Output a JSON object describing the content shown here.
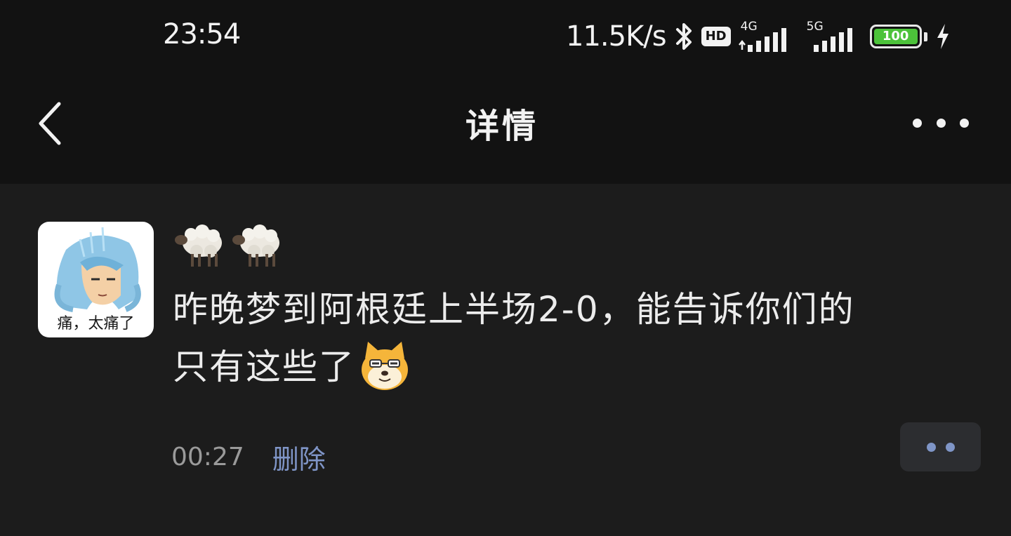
{
  "status_bar": {
    "time": "23:54",
    "net_speed": "11.5K/s",
    "hd": "HD",
    "signal_1_label": "4G",
    "signal_2_label": "5G",
    "battery_level": "100",
    "bluetooth_icon": "bluetooth-icon",
    "charging_icon": "lightning-icon"
  },
  "nav": {
    "back_icon": "chevron-left-icon",
    "title": "详情",
    "more_icon": "more-dots-icon"
  },
  "post": {
    "avatar_caption": "痛，太痛了",
    "emojis": [
      "sheep",
      "sheep"
    ],
    "text_line_1": "昨晚梦到阿根廷上半场2-0，能告诉你们的",
    "text_line_2": "只有这些了",
    "trailing_emoji": "doge",
    "time": "00:27",
    "delete_label": "删除",
    "comment_icon": "comment-dots-icon"
  },
  "colors": {
    "background": "#1c1c1c",
    "header_background": "#121212",
    "link": "#7f95c7",
    "battery": "#4cc23a"
  }
}
